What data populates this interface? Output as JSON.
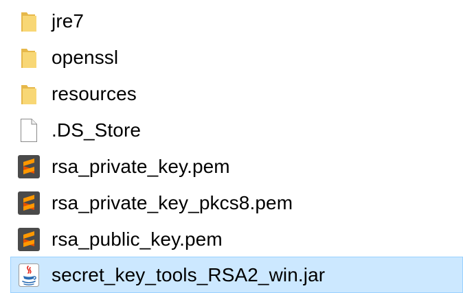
{
  "colors": {
    "folder": "#f8d775",
    "folder_dark": "#e6b84a",
    "sublime_bg": "#4a4a4a",
    "sublime_accent": "#ff9800",
    "selection_bg": "#cce8ff",
    "selection_border": "#99d1ff"
  },
  "files": [
    {
      "name": "jre7",
      "icon": "folder-icon",
      "selected": false
    },
    {
      "name": "openssl",
      "icon": "folder-icon",
      "selected": false
    },
    {
      "name": "resources",
      "icon": "folder-icon",
      "selected": false
    },
    {
      "name": ".DS_Store",
      "icon": "blank-file-icon",
      "selected": false
    },
    {
      "name": "rsa_private_key.pem",
      "icon": "sublime-text-icon",
      "selected": false
    },
    {
      "name": "rsa_private_key_pkcs8.pem",
      "icon": "sublime-text-icon",
      "selected": false
    },
    {
      "name": "rsa_public_key.pem",
      "icon": "sublime-text-icon",
      "selected": false
    },
    {
      "name": "secret_key_tools_RSA2_win.jar",
      "icon": "java-jar-icon",
      "selected": true
    }
  ]
}
